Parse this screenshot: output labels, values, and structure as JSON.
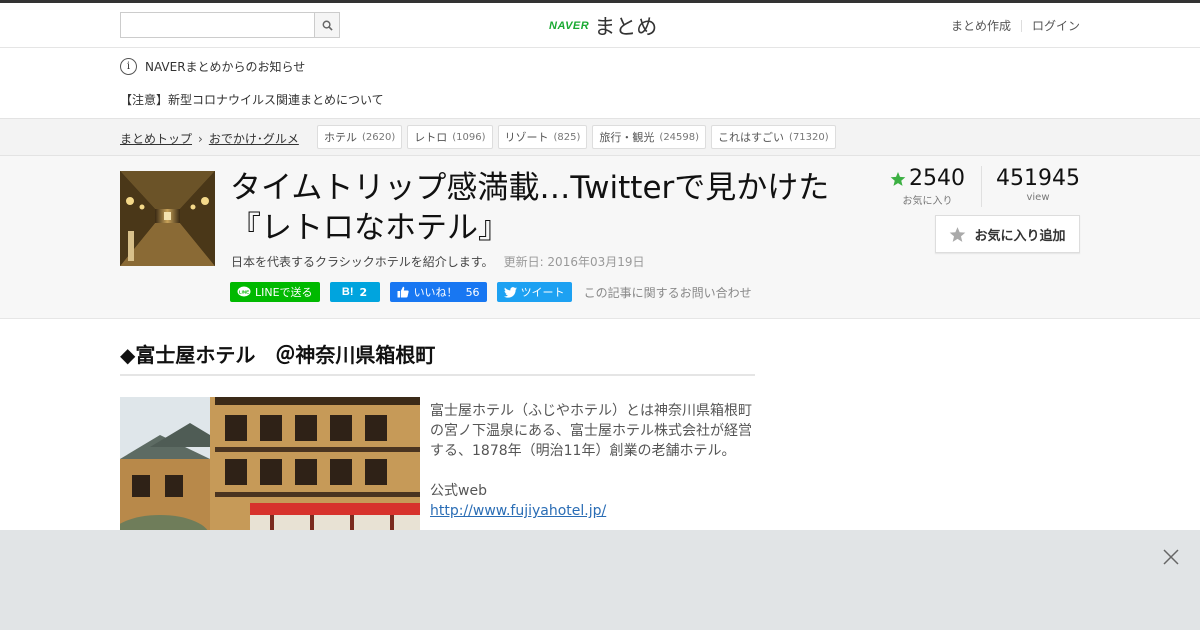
{
  "header": {
    "search_placeholder": "",
    "logo_brand": "NAVER",
    "logo_text": "まとめ",
    "nav": [
      "まとめ作成",
      "ログイン"
    ]
  },
  "notice": {
    "title": "NAVERまとめからのお知らせ",
    "message": "【注意】新型コロナウイルス関連まとめについて"
  },
  "breadcrumb": {
    "items": [
      "まとめトップ",
      "おでかけ･グルメ"
    ]
  },
  "tags": [
    {
      "label": "ホテル",
      "count": "(2620)"
    },
    {
      "label": "レトロ",
      "count": "(1096)"
    },
    {
      "label": "リゾート",
      "count": "(825)"
    },
    {
      "label": "旅行・観光",
      "count": "(24598)"
    },
    {
      "label": "これはすごい",
      "count": "(71320)"
    }
  ],
  "article": {
    "title": "タイムトリップ感満載…Twitterで見かけた『レトロなホテル』",
    "description": "日本を代表するクラシックホテルを紹介します。",
    "updated": "更新日: 2016年03月19日",
    "favorites": "2540",
    "favorites_label": "お気に入り",
    "views": "451945",
    "views_label": "view",
    "fav_button": "お気に入り追加",
    "inquiry": "この記事に関するお問い合わせ"
  },
  "share": {
    "line": "LINEで送る",
    "hatena": "B!",
    "hatena_count": "2",
    "facebook": "いいね！",
    "facebook_count": "56",
    "twitter": "ツイート"
  },
  "section": {
    "heading": "◆富士屋ホテル　＠神奈川県箱根町",
    "text": "富士屋ホテル（ふじやホテル）とは神奈川県箱根町の宮ノ下温泉にある、富士屋ホテル株式会社が経営する、1878年（明治11年）創業の老舗ホテル。",
    "web_label": "公式web",
    "link": "http://www.fujiyahotel.jp/"
  },
  "colors": {
    "line_green": "#00b900",
    "hatena_blue": "#00a4de",
    "facebook_blue": "#1877f2",
    "twitter_blue": "#1da1f2",
    "star_green": "#3cb043",
    "link_blue": "#2a6db5"
  }
}
